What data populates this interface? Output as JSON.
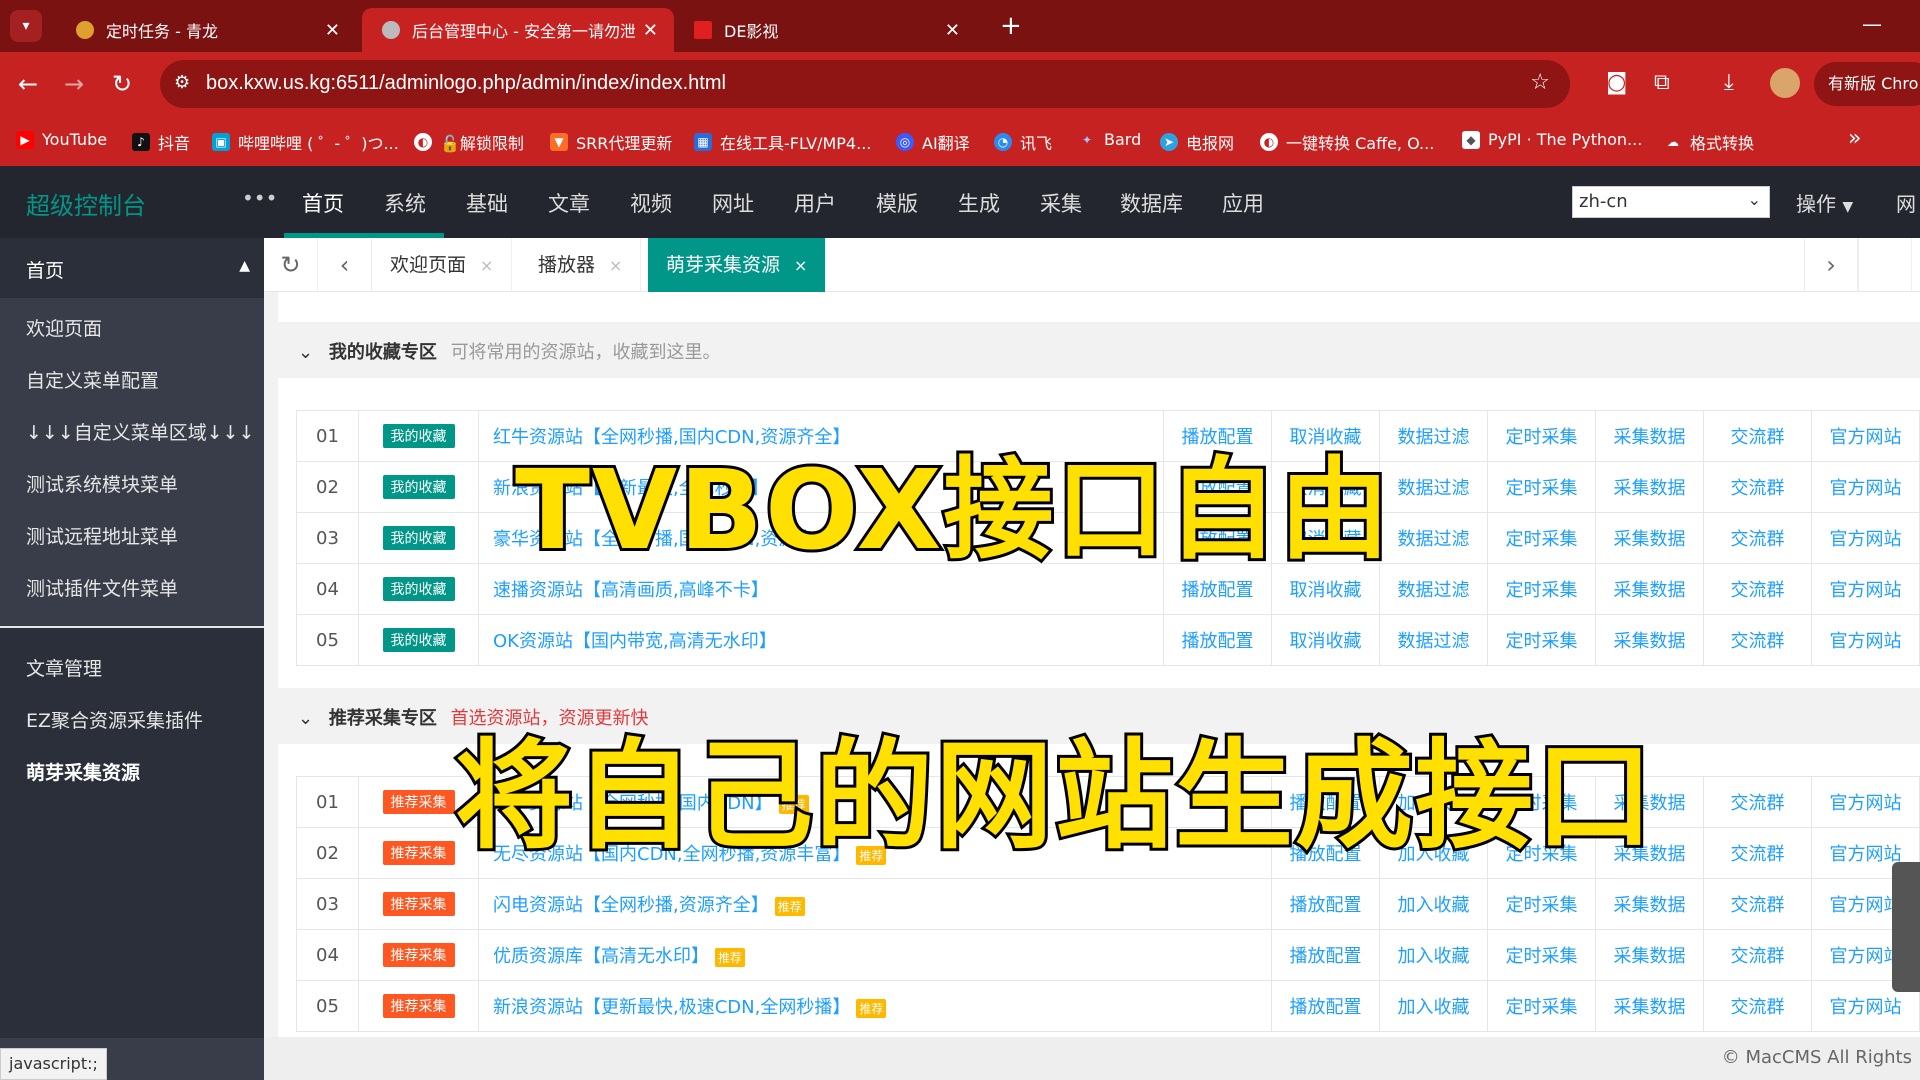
{
  "browser": {
    "tabs": [
      {
        "title": "定时任务 - 青龙",
        "favicon_color": "#e0a030"
      },
      {
        "title": "后台管理中心 - 安全第一请勿泄",
        "favicon_color": "#bbbbbb"
      },
      {
        "title": "DE影视",
        "favicon_color": "#e02020"
      }
    ],
    "url": "box.kxw.us.kg:6511/adminlogo.php/admin/index/index.html",
    "update_button": "有新版 Chro",
    "bookmarks": [
      {
        "label": "YouTube",
        "icon": "youtube-icon",
        "color": "#ff0000"
      },
      {
        "label": "抖音",
        "icon": "tiktok-icon",
        "color": "#111111"
      },
      {
        "label": "哔哩哔哩 ( ゜- ゜)つ...",
        "icon": "bilibili-icon",
        "color": "#00a1d6"
      },
      {
        "label": "🔓解锁限制",
        "icon": "globe-icon",
        "color": "#ffffff"
      },
      {
        "label": "SRR代理更新",
        "icon": "gitlab-icon",
        "color": "#fc6d26"
      },
      {
        "label": "在线工具-FLV/MP4...",
        "icon": "tools-icon",
        "color": "#2b6cd6"
      },
      {
        "label": "AI翻译",
        "icon": "translate-icon",
        "color": "#3c5bff"
      },
      {
        "label": "讯飞",
        "icon": "xunfei-icon",
        "color": "#2a8bf2"
      },
      {
        "label": "Bard",
        "icon": "bard-icon",
        "color": "#5b8cf7"
      },
      {
        "label": "电报网",
        "icon": "telegram-icon",
        "color": "#2aa3e0"
      },
      {
        "label": "一键转换 Caffe, O...",
        "icon": "globe-icon",
        "color": "#ffffff"
      },
      {
        "label": "PyPI · The Python...",
        "icon": "pypi-icon",
        "color": "#ffffff"
      },
      {
        "label": "格式转换",
        "icon": "cloud-icon",
        "color": "#ffffff"
      }
    ]
  },
  "app": {
    "logo": "超级控制台",
    "more": "•••",
    "topnav": [
      "首页",
      "系统",
      "基础",
      "文章",
      "视频",
      "网址",
      "用户",
      "模版",
      "生成",
      "采集",
      "数据库",
      "应用"
    ],
    "language": "zh-cn",
    "operate": "操作",
    "right_cut": "网"
  },
  "sidebar": {
    "head": "首页",
    "items": [
      "欢迎页面",
      "自定义菜单配置",
      "↓↓↓自定义菜单区域↓↓↓",
      "测试系统模块菜单",
      "测试远程地址菜单",
      "测试插件文件菜单"
    ],
    "lower_items": [
      "文章管理",
      "EZ聚合资源采集插件",
      "萌芽采集资源"
    ]
  },
  "content_tabs": [
    {
      "label": "欢迎页面",
      "close": "×"
    },
    {
      "label": "播放器",
      "close": "×"
    },
    {
      "label": "萌芽采集资源",
      "close": "×"
    }
  ],
  "favorites": {
    "title": "我的收藏专区",
    "desc": "可将常用的资源站，收藏到这里。",
    "rows": [
      {
        "no": "01",
        "badge": "我的收藏",
        "name": "红牛资源站【全网秒播,国内CDN,资源齐全】",
        "actions": [
          "播放配置",
          "取消收藏",
          "数据过滤",
          "定时采集",
          "采集数据",
          "交流群",
          "官方网站"
        ]
      },
      {
        "no": "02",
        "badge": "我的收藏",
        "name": "新浪资源站【更新最快,全网秒播】",
        "actions": [
          "播放配置",
          "取消收藏",
          "数据过滤",
          "定时采集",
          "采集数据",
          "交流群",
          "官方网站"
        ]
      },
      {
        "no": "03",
        "badge": "我的收藏",
        "name": "豪华资源站【全网秒播,国内CDN,资源齐全】",
        "actions": [
          "播放配置",
          "取消收藏",
          "数据过滤",
          "定时采集",
          "采集数据",
          "交流群",
          "官方网站"
        ]
      },
      {
        "no": "04",
        "badge": "我的收藏",
        "name": "速播资源站【高清画质,高峰不卡】",
        "actions": [
          "播放配置",
          "取消收藏",
          "数据过滤",
          "定时采集",
          "采集数据",
          "交流群",
          "官方网站"
        ]
      },
      {
        "no": "05",
        "badge": "我的收藏",
        "name": "OK资源站【国内带宽,高清无水印】",
        "actions": [
          "播放配置",
          "取消收藏",
          "数据过滤",
          "定时采集",
          "采集数据",
          "交流群",
          "官方网站"
        ]
      }
    ]
  },
  "recommended": {
    "title": "推荐采集专区",
    "desc": "首选资源站，资源更新快",
    "hot": "推荐",
    "rows": [
      {
        "no": "01",
        "badge": "推荐采集",
        "name": "红牛资源站【全网秒播,国内CDN】",
        "actions": [
          "播放配置",
          "加入收藏",
          "定时采集",
          "采集数据",
          "交流群",
          "官方网站"
        ]
      },
      {
        "no": "02",
        "badge": "推荐采集",
        "name": "无尽资源站【国内CDN,全网秒播,资源丰富】",
        "actions": [
          "播放配置",
          "加入收藏",
          "定时采集",
          "采集数据",
          "交流群",
          "官方网站"
        ]
      },
      {
        "no": "03",
        "badge": "推荐采集",
        "name": "闪电资源站【全网秒播,资源齐全】",
        "actions": [
          "播放配置",
          "加入收藏",
          "定时采集",
          "采集数据",
          "交流群",
          "官方网站"
        ]
      },
      {
        "no": "04",
        "badge": "推荐采集",
        "name": "优质资源库【高清无水印】",
        "actions": [
          "播放配置",
          "加入收藏",
          "定时采集",
          "采集数据",
          "交流群",
          "官方网站"
        ]
      },
      {
        "no": "05",
        "badge": "推荐采集",
        "name": "新浪资源站【更新最快,极速CDN,全网秒播】",
        "actions": [
          "播放配置",
          "加入收藏",
          "定时采集",
          "采集数据",
          "交流群",
          "官方网站"
        ]
      }
    ]
  },
  "overlay": {
    "line1": "TVBOX接口自由",
    "line2": "将自己的网站生成接口"
  },
  "footer": "© MacCMS All Rights",
  "status_url": "javascript:;"
}
